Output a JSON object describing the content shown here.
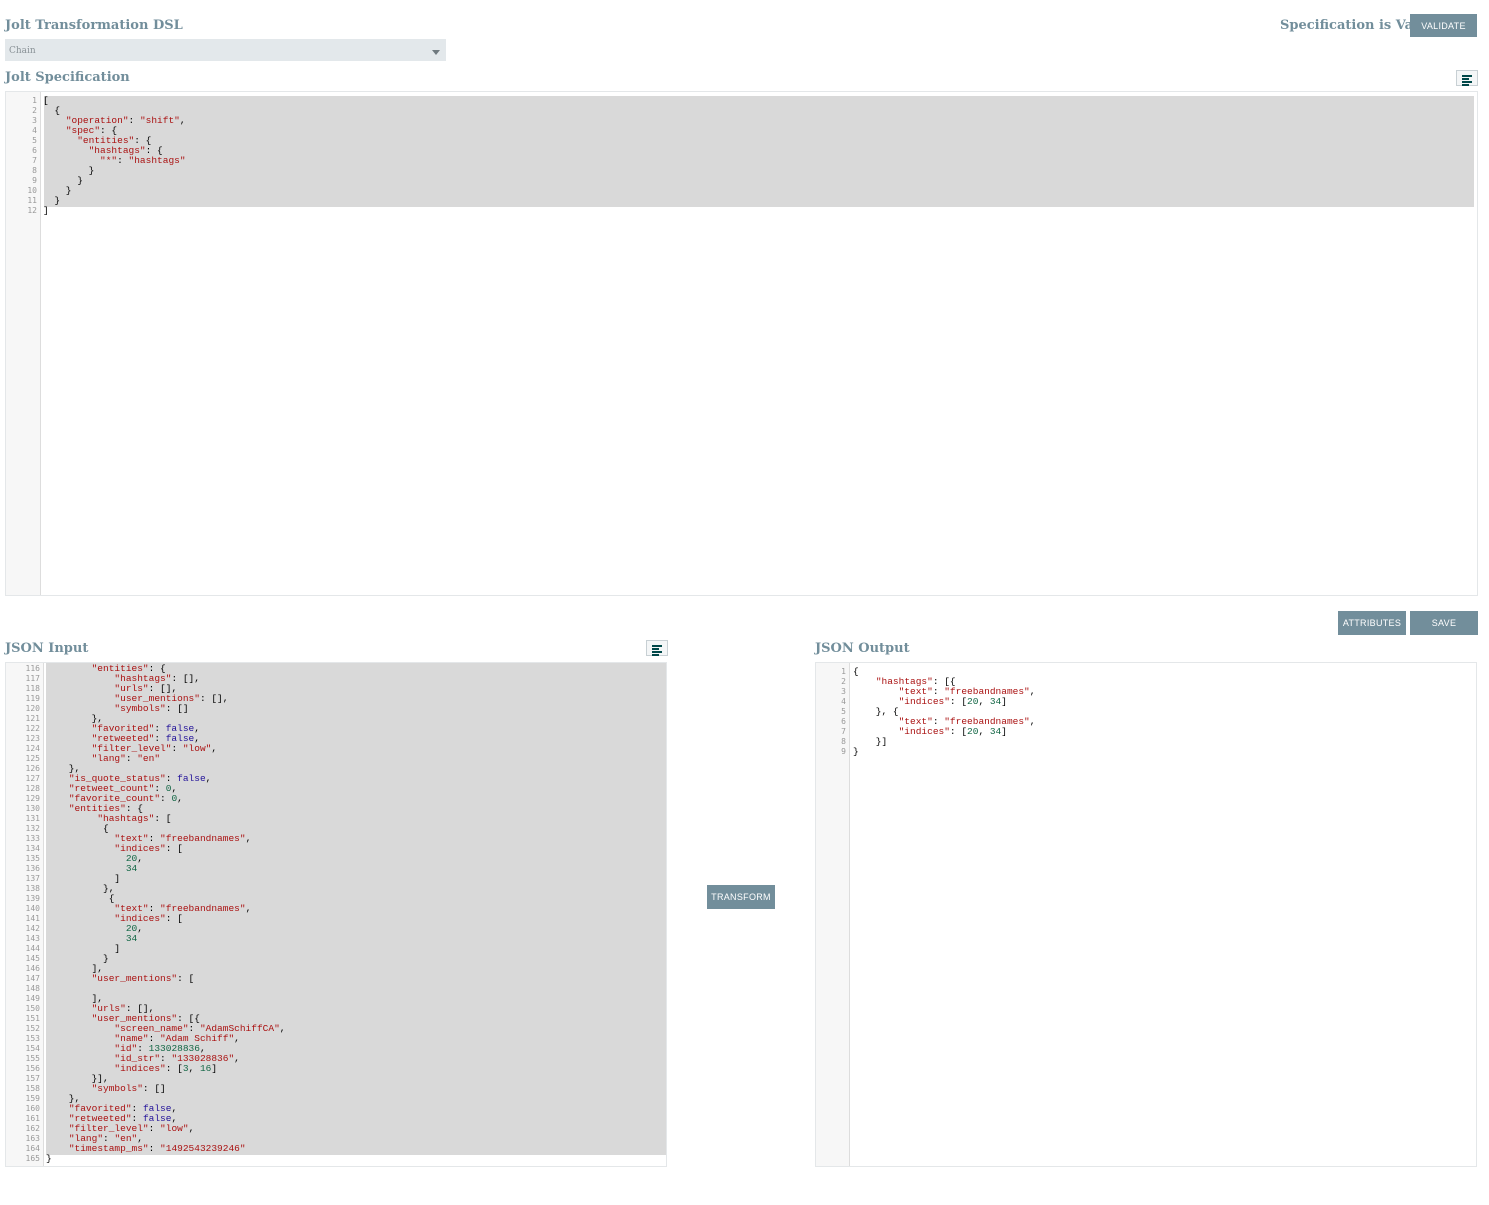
{
  "header": {
    "dsl_label": "Jolt Transformation DSL",
    "dsl_selected": "Chain",
    "validation_status": "Specification is Valid",
    "validate_button": "VALIDATE"
  },
  "spec": {
    "label": "Jolt Specification",
    "line_numbers": [
      "1",
      "2",
      "3",
      "4",
      "5",
      "6",
      "7",
      "8",
      "9",
      "10",
      "11",
      "12"
    ],
    "lines": [
      [
        [
          "",
          "["
        ]
      ],
      [
        [
          "",
          "  {"
        ]
      ],
      [
        [
          "",
          "    "
        ],
        [
          "s",
          "\"operation\""
        ],
        [
          "",
          ": "
        ],
        [
          "s",
          "\"shift\""
        ],
        [
          "",
          ","
        ]
      ],
      [
        [
          "",
          "    "
        ],
        [
          "s",
          "\"spec\""
        ],
        [
          "",
          ": {"
        ]
      ],
      [
        [
          "",
          "      "
        ],
        [
          "s",
          "\"entities\""
        ],
        [
          "",
          ": {"
        ]
      ],
      [
        [
          "",
          "        "
        ],
        [
          "s",
          "\"hashtags\""
        ],
        [
          "",
          ": {"
        ]
      ],
      [
        [
          "",
          "          "
        ],
        [
          "s",
          "\"*\""
        ],
        [
          "",
          ": "
        ],
        [
          "s",
          "\"hashtags\""
        ]
      ],
      [
        [
          "",
          "        }"
        ]
      ],
      [
        [
          "",
          "      }"
        ]
      ],
      [
        [
          "",
          "    }"
        ]
      ],
      [
        [
          "",
          "  }"
        ]
      ],
      [
        [
          "",
          "]"
        ]
      ]
    ]
  },
  "actions": {
    "attributes_button": "ATTRIBUTES",
    "save_button": "SAVE",
    "transform_button": "TRANSFORM"
  },
  "input": {
    "label": "JSON Input",
    "line_numbers": [
      "116",
      "117",
      "118",
      "119",
      "120",
      "121",
      "122",
      "123",
      "124",
      "125",
      "126",
      "127",
      "128",
      "129",
      "130",
      "131",
      "132",
      "133",
      "134",
      "135",
      "136",
      "137",
      "138",
      "139",
      "140",
      "141",
      "142",
      "143",
      "144",
      "145",
      "146",
      "147",
      "148",
      "149",
      "150",
      "151",
      "152",
      "153",
      "154",
      "155",
      "156",
      "157",
      "158",
      "159",
      "160",
      "161",
      "162",
      "163",
      "164",
      "165"
    ],
    "lines": [
      [
        [
          "",
          "        "
        ],
        [
          "s",
          "\"entities\""
        ],
        [
          "",
          ": {"
        ]
      ],
      [
        [
          "",
          "            "
        ],
        [
          "s",
          "\"hashtags\""
        ],
        [
          "",
          ": [],"
        ]
      ],
      [
        [
          "",
          "            "
        ],
        [
          "s",
          "\"urls\""
        ],
        [
          "",
          ": [],"
        ]
      ],
      [
        [
          "",
          "            "
        ],
        [
          "s",
          "\"user_mentions\""
        ],
        [
          "",
          ": [],"
        ]
      ],
      [
        [
          "",
          "            "
        ],
        [
          "s",
          "\"symbols\""
        ],
        [
          "",
          ": []"
        ]
      ],
      [
        [
          "",
          "        },"
        ]
      ],
      [
        [
          "",
          "        "
        ],
        [
          "s",
          "\"favorited\""
        ],
        [
          "",
          ": "
        ],
        [
          "k",
          "false"
        ],
        [
          "",
          ","
        ]
      ],
      [
        [
          "",
          "        "
        ],
        [
          "s",
          "\"retweeted\""
        ],
        [
          "",
          ": "
        ],
        [
          "k",
          "false"
        ],
        [
          "",
          ","
        ]
      ],
      [
        [
          "",
          "        "
        ],
        [
          "s",
          "\"filter_level\""
        ],
        [
          "",
          ": "
        ],
        [
          "s",
          "\"low\""
        ],
        [
          "",
          ","
        ]
      ],
      [
        [
          "",
          "        "
        ],
        [
          "s",
          "\"lang\""
        ],
        [
          "",
          ": "
        ],
        [
          "s",
          "\"en\""
        ]
      ],
      [
        [
          "",
          "    },"
        ]
      ],
      [
        [
          "",
          "    "
        ],
        [
          "s",
          "\"is_quote_status\""
        ],
        [
          "",
          ": "
        ],
        [
          "k",
          "false"
        ],
        [
          "",
          ","
        ]
      ],
      [
        [
          "",
          "    "
        ],
        [
          "s",
          "\"retweet_count\""
        ],
        [
          "",
          ": "
        ],
        [
          "n",
          "0"
        ],
        [
          "",
          ","
        ]
      ],
      [
        [
          "",
          "    "
        ],
        [
          "s",
          "\"favorite_count\""
        ],
        [
          "",
          ": "
        ],
        [
          "n",
          "0"
        ],
        [
          "",
          ","
        ]
      ],
      [
        [
          "",
          "    "
        ],
        [
          "s",
          "\"entities\""
        ],
        [
          "",
          ": {"
        ]
      ],
      [
        [
          "",
          "         "
        ],
        [
          "s",
          "\"hashtags\""
        ],
        [
          "",
          ": ["
        ]
      ],
      [
        [
          "",
          "          {"
        ]
      ],
      [
        [
          "",
          "            "
        ],
        [
          "s",
          "\"text\""
        ],
        [
          "",
          ": "
        ],
        [
          "s",
          "\"freebandnames\""
        ],
        [
          "",
          ","
        ]
      ],
      [
        [
          "",
          "            "
        ],
        [
          "s",
          "\"indices\""
        ],
        [
          "",
          ": ["
        ]
      ],
      [
        [
          "",
          "              "
        ],
        [
          "n",
          "20"
        ],
        [
          "",
          ","
        ]
      ],
      [
        [
          "",
          "              "
        ],
        [
          "n",
          "34"
        ]
      ],
      [
        [
          "",
          "            ]"
        ]
      ],
      [
        [
          "",
          "          },"
        ]
      ],
      [
        [
          "",
          "           {"
        ]
      ],
      [
        [
          "",
          "            "
        ],
        [
          "s",
          "\"text\""
        ],
        [
          "",
          ": "
        ],
        [
          "s",
          "\"freebandnames\""
        ],
        [
          "",
          ","
        ]
      ],
      [
        [
          "",
          "            "
        ],
        [
          "s",
          "\"indices\""
        ],
        [
          "",
          ": ["
        ]
      ],
      [
        [
          "",
          "              "
        ],
        [
          "n",
          "20"
        ],
        [
          "",
          ","
        ]
      ],
      [
        [
          "",
          "              "
        ],
        [
          "n",
          "34"
        ]
      ],
      [
        [
          "",
          "            ]"
        ]
      ],
      [
        [
          "",
          "          }"
        ]
      ],
      [
        [
          "",
          "        ],"
        ]
      ],
      [
        [
          "",
          "        "
        ],
        [
          "s",
          "\"user_mentions\""
        ],
        [
          "",
          ": ["
        ]
      ],
      [
        [
          "",
          ""
        ]
      ],
      [
        [
          "",
          "        ],"
        ]
      ],
      [
        [
          "",
          "        "
        ],
        [
          "s",
          "\"urls\""
        ],
        [
          "",
          ": [],"
        ]
      ],
      [
        [
          "",
          "        "
        ],
        [
          "s",
          "\"user_mentions\""
        ],
        [
          "",
          ": [{"
        ]
      ],
      [
        [
          "",
          "            "
        ],
        [
          "s",
          "\"screen_name\""
        ],
        [
          "",
          ": "
        ],
        [
          "s",
          "\"AdamSchiffCA\""
        ],
        [
          "",
          ","
        ]
      ],
      [
        [
          "",
          "            "
        ],
        [
          "s",
          "\"name\""
        ],
        [
          "",
          ": "
        ],
        [
          "s",
          "\"Adam Schiff\""
        ],
        [
          "",
          ","
        ]
      ],
      [
        [
          "",
          "            "
        ],
        [
          "s",
          "\"id\""
        ],
        [
          "",
          ": "
        ],
        [
          "n",
          "133028836"
        ],
        [
          "",
          ","
        ]
      ],
      [
        [
          "",
          "            "
        ],
        [
          "s",
          "\"id_str\""
        ],
        [
          "",
          ": "
        ],
        [
          "s",
          "\"133028836\""
        ],
        [
          "",
          ","
        ]
      ],
      [
        [
          "",
          "            "
        ],
        [
          "s",
          "\"indices\""
        ],
        [
          "",
          ": ["
        ],
        [
          "n",
          "3"
        ],
        [
          "",
          ", "
        ],
        [
          "n",
          "16"
        ],
        [
          "",
          "]"
        ]
      ],
      [
        [
          "",
          "        }],"
        ]
      ],
      [
        [
          "",
          "        "
        ],
        [
          "s",
          "\"symbols\""
        ],
        [
          "",
          ": []"
        ]
      ],
      [
        [
          "",
          "    },"
        ]
      ],
      [
        [
          "",
          "    "
        ],
        [
          "s",
          "\"favorited\""
        ],
        [
          "",
          ": "
        ],
        [
          "k",
          "false"
        ],
        [
          "",
          ","
        ]
      ],
      [
        [
          "",
          "    "
        ],
        [
          "s",
          "\"retweeted\""
        ],
        [
          "",
          ": "
        ],
        [
          "k",
          "false"
        ],
        [
          "",
          ","
        ]
      ],
      [
        [
          "",
          "    "
        ],
        [
          "s",
          "\"filter_level\""
        ],
        [
          "",
          ": "
        ],
        [
          "s",
          "\"low\""
        ],
        [
          "",
          ","
        ]
      ],
      [
        [
          "",
          "    "
        ],
        [
          "s",
          "\"lang\""
        ],
        [
          "",
          ": "
        ],
        [
          "s",
          "\"en\""
        ],
        [
          "",
          ","
        ]
      ],
      [
        [
          "",
          "    "
        ],
        [
          "s",
          "\"timestamp_ms\""
        ],
        [
          "",
          ": "
        ],
        [
          "s",
          "\"1492543239246\""
        ]
      ],
      [
        [
          "",
          "}"
        ]
      ]
    ]
  },
  "output": {
    "label": "JSON Output",
    "line_numbers": [
      "1",
      "2",
      "3",
      "4",
      "5",
      "6",
      "7",
      "8",
      "9"
    ],
    "lines": [
      [
        [
          "",
          "{"
        ]
      ],
      [
        [
          "",
          "    "
        ],
        [
          "s",
          "\"hashtags\""
        ],
        [
          "",
          ": [{"
        ]
      ],
      [
        [
          "",
          "        "
        ],
        [
          "s",
          "\"text\""
        ],
        [
          "",
          ": "
        ],
        [
          "s",
          "\"freebandnames\""
        ],
        [
          "",
          ","
        ]
      ],
      [
        [
          "",
          "        "
        ],
        [
          "s",
          "\"indices\""
        ],
        [
          "",
          ": ["
        ],
        [
          "n",
          "20"
        ],
        [
          "",
          ", "
        ],
        [
          "n",
          "34"
        ],
        [
          "",
          "]"
        ]
      ],
      [
        [
          "",
          "    }, {"
        ]
      ],
      [
        [
          "",
          "        "
        ],
        [
          "s",
          "\"text\""
        ],
        [
          "",
          ": "
        ],
        [
          "s",
          "\"freebandnames\""
        ],
        [
          "",
          ","
        ]
      ],
      [
        [
          "",
          "        "
        ],
        [
          "s",
          "\"indices\""
        ],
        [
          "",
          ": ["
        ],
        [
          "n",
          "20"
        ],
        [
          "",
          ", "
        ],
        [
          "n",
          "34"
        ],
        [
          "",
          "]"
        ]
      ],
      [
        [
          "",
          "    }]"
        ]
      ],
      [
        [
          "",
          "}"
        ]
      ]
    ]
  },
  "colors": {
    "accent": "#728e9b",
    "highlight": "#d9d9d9",
    "string": "#aa1111",
    "keyword": "#221199",
    "number": "#116644"
  },
  "icons": {
    "format": "format-lines-icon",
    "dropdown": "chevron-down-icon"
  }
}
